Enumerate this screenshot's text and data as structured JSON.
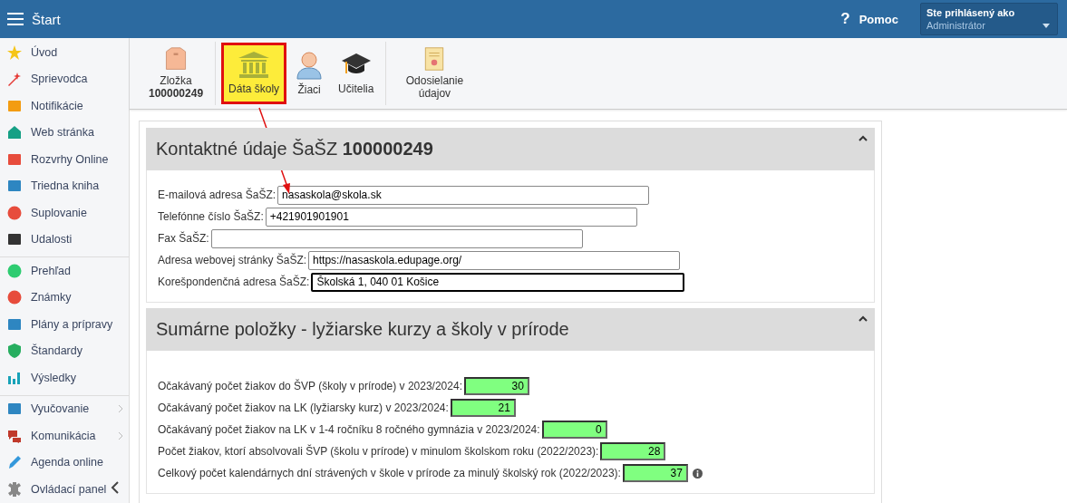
{
  "header": {
    "title": "Štart",
    "help_icon": "?",
    "help": "Pomoc",
    "user_label": "Ste prihlásený ako",
    "user_role": "Administrátor"
  },
  "sidebar": {
    "groups": [
      {
        "items": [
          {
            "label": "Úvod",
            "has_submenu": false
          },
          {
            "label": "Sprievodca",
            "has_submenu": false
          },
          {
            "label": "Notifikácie",
            "has_submenu": false
          },
          {
            "label": "Web stránka",
            "has_submenu": false
          },
          {
            "label": "Rozvrhy Online",
            "has_submenu": false
          },
          {
            "label": "Triedna kniha",
            "has_submenu": false
          },
          {
            "label": "Suplovanie",
            "has_submenu": false
          },
          {
            "label": "Udalosti",
            "has_submenu": false
          }
        ]
      },
      {
        "items": [
          {
            "label": "Prehľad",
            "has_submenu": false
          },
          {
            "label": "Známky",
            "has_submenu": false
          },
          {
            "label": "Plány a prípravy",
            "has_submenu": false
          },
          {
            "label": "Štandardy",
            "has_submenu": false
          },
          {
            "label": "Výsledky",
            "has_submenu": false
          }
        ]
      },
      {
        "items": [
          {
            "label": "Vyučovanie",
            "has_submenu": true
          },
          {
            "label": "Komunikácia",
            "has_submenu": true
          },
          {
            "label": "Agenda online",
            "has_submenu": false
          },
          {
            "label": "Ovládací panel",
            "has_submenu": false
          }
        ]
      }
    ]
  },
  "toolbar": [
    {
      "label": "Zložka",
      "sublabel": "100000249",
      "selected": false
    },
    {
      "label": "Dáta školy",
      "selected": true
    },
    {
      "label": "Žiaci",
      "selected": false
    },
    {
      "label": "Učitelia",
      "selected": false
    },
    {
      "label": "Odosielanie údajov",
      "selected": false
    }
  ],
  "sections": [
    {
      "title": "Kontaktné údaje ŠaŠZ **100000249**",
      "expanded": true,
      "fields": [
        {
          "label": "E-mailová adresa ŠaŠZ:",
          "value": "nasaskola@skola.sk",
          "focused": false
        },
        {
          "label": "Telefónne číslo ŠaŠZ:",
          "value": "+421901901901",
          "focused": false
        },
        {
          "label": "Fax ŠaŠZ:",
          "focused": false
        },
        {
          "label": "Adresa webovej stránky ŠaŠZ:",
          "value": "https://nasaskola.edupage.org/",
          "focused": false
        },
        {
          "label": "Korešpondenčná adresa ŠaŠZ:",
          "value": "Školská 1, 040 01 Košice",
          "focused": true
        }
      ]
    },
    {
      "title": "Sumárne položky - lyžiarske kurzy a školy v prírode",
      "expanded": true,
      "numbers": [
        {
          "label": "Očakávaný počet žiakov do ŠVP (školy v prírode) v 2023/2024:",
          "value": "30",
          "info": false
        },
        {
          "label": "Očakávaný počet žiakov na LK (lyžiarsky kurz) v 2023/2024:",
          "value": "21",
          "info": false
        },
        {
          "label": "Očakávaný počet žiakov na LK v 1-4 ročníku 8 ročného gymnázia v 2023/2024:",
          "value": "0",
          "info": false
        },
        {
          "label": "Počet žiakov, ktorí absolvovali ŠVP (školu v prírode) v minulom školskom roku (2022/2023):",
          "value": "28",
          "info": false
        },
        {
          "label": "Celkový počet kalendárnych dní strávených v škole v prírode za minulý školský rok (2022/2023):",
          "value": "37",
          "info": true
        }
      ]
    }
  ]
}
